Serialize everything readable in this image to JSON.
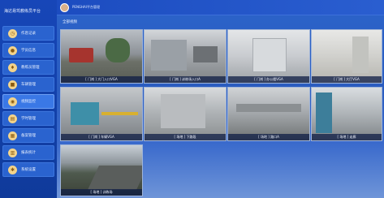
{
  "app": {
    "title": "海达易驾教练员平台"
  },
  "header": {
    "title": "PENGHAI平台管理"
  },
  "main": {
    "section_label": "全部视频"
  },
  "sidebar": {
    "items": [
      {
        "label": "作息记录",
        "icon": "clock-icon"
      },
      {
        "label": "学员信息",
        "icon": "user-icon"
      },
      {
        "label": "教练员管理",
        "icon": "coach-icon"
      },
      {
        "label": "车辆管理",
        "icon": "car-icon"
      },
      {
        "label": "视频监控",
        "icon": "camera-icon"
      },
      {
        "label": "学时管理",
        "icon": "book-icon"
      },
      {
        "label": "备案管理",
        "icon": "file-icon"
      },
      {
        "label": "报表统计",
        "icon": "chart-icon"
      },
      {
        "label": "系统设置",
        "icon": "gear-icon"
      }
    ]
  },
  "cameras": [
    {
      "caption": "[ 门岗 ] 大门入口VGA"
    },
    {
      "caption": "[ 门岗 ] 训练场入口A"
    },
    {
      "caption": "[ 门岗 ] 办公楼VGA"
    },
    {
      "caption": "[ 门岗 ] 大厅VGA"
    },
    {
      "caption": "[ 门岗 ] 车辆VGA"
    },
    {
      "caption": "[ 场地 ] 下路段"
    },
    {
      "caption": "[ 场地 ] 路口A"
    },
    {
      "caption": "[ 场地 ] 走廊"
    },
    {
      "caption": "[ 场地 ] 训练场"
    }
  ]
}
